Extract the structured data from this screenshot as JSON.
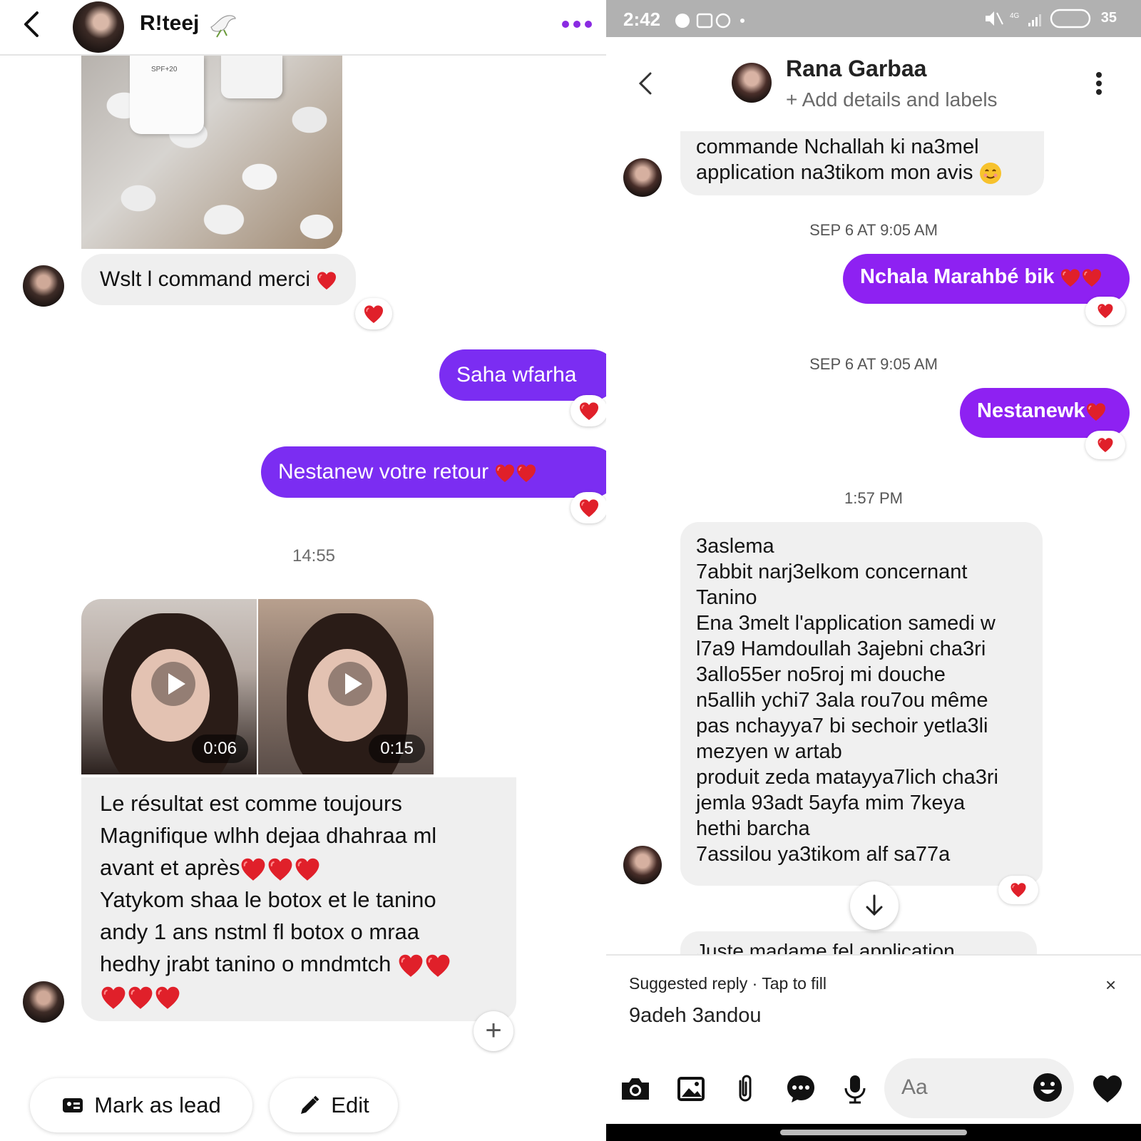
{
  "left": {
    "header": {
      "contact_name": "R!teej"
    },
    "msg_received_1": "Wslt l command merci",
    "msg_sent_1": "Saha wfarha",
    "msg_sent_2": "Nestanew votre retour",
    "timestamp": "14:55",
    "videos": [
      {
        "duration": "0:06"
      },
      {
        "duration": "0:15"
      }
    ],
    "long_message": [
      "Le résultat est comme toujours",
      "Magnifique wlhh dejaa dhahraa ml",
      "avant et après",
      "Yatykom shaa  le botox et le tanino",
      "andy 1 ans nstml fl botox o mraa",
      "hedhy jrabt tanino o mndmtch",
      ""
    ],
    "buttons": {
      "mark_as_lead": "Mark as lead",
      "edit": "Edit"
    }
  },
  "right": {
    "status_bar": {
      "time": "2:42",
      "battery": "35"
    },
    "header": {
      "contact_name": "Rana Garbaa",
      "subtitle": "+ Add details and labels"
    },
    "msg_received_top": [
      "commande Nchallah ki na3mel",
      "application na3tikom mon avis"
    ],
    "timestamp_1": "SEP 6 AT 9:05 AM",
    "msg_sent_1": "Nchala Marahbé bik",
    "timestamp_2": "SEP 6 AT 9:05 AM",
    "msg_sent_2": "Nestanewk",
    "timestamp_3": "1:57 PM",
    "long_message": [
      "3aslema",
      "7abbit narj3elkom concernant",
      "Tanino",
      "Ena 3melt l'application samedi w",
      "l7a9 Hamdoullah 3ajebni cha3ri",
      "3allo55er no5roj mi douche",
      "n5allih ychi7 3ala rou7ou même",
      "pas nchayya7 bi sechoir yetla3li",
      "mezyen w artab",
      "produit zeda matayya7lich cha3ri",
      "jemla 93adt 5ayfa mim 7keya",
      "hethi barcha",
      "7assilou ya3tikom alf sa77a"
    ],
    "cutoff_message": "Juste madame fel application",
    "suggested_reply": {
      "heading": "Suggested reply · Tap to fill",
      "text": "9adeh 3andou",
      "close": "×"
    },
    "composer": {
      "placeholder": "Aa"
    }
  },
  "colors": {
    "sent_left": "#7b2df2",
    "sent_right": "#8e21f2",
    "received": "#efefef",
    "heart": "#e0202a"
  }
}
